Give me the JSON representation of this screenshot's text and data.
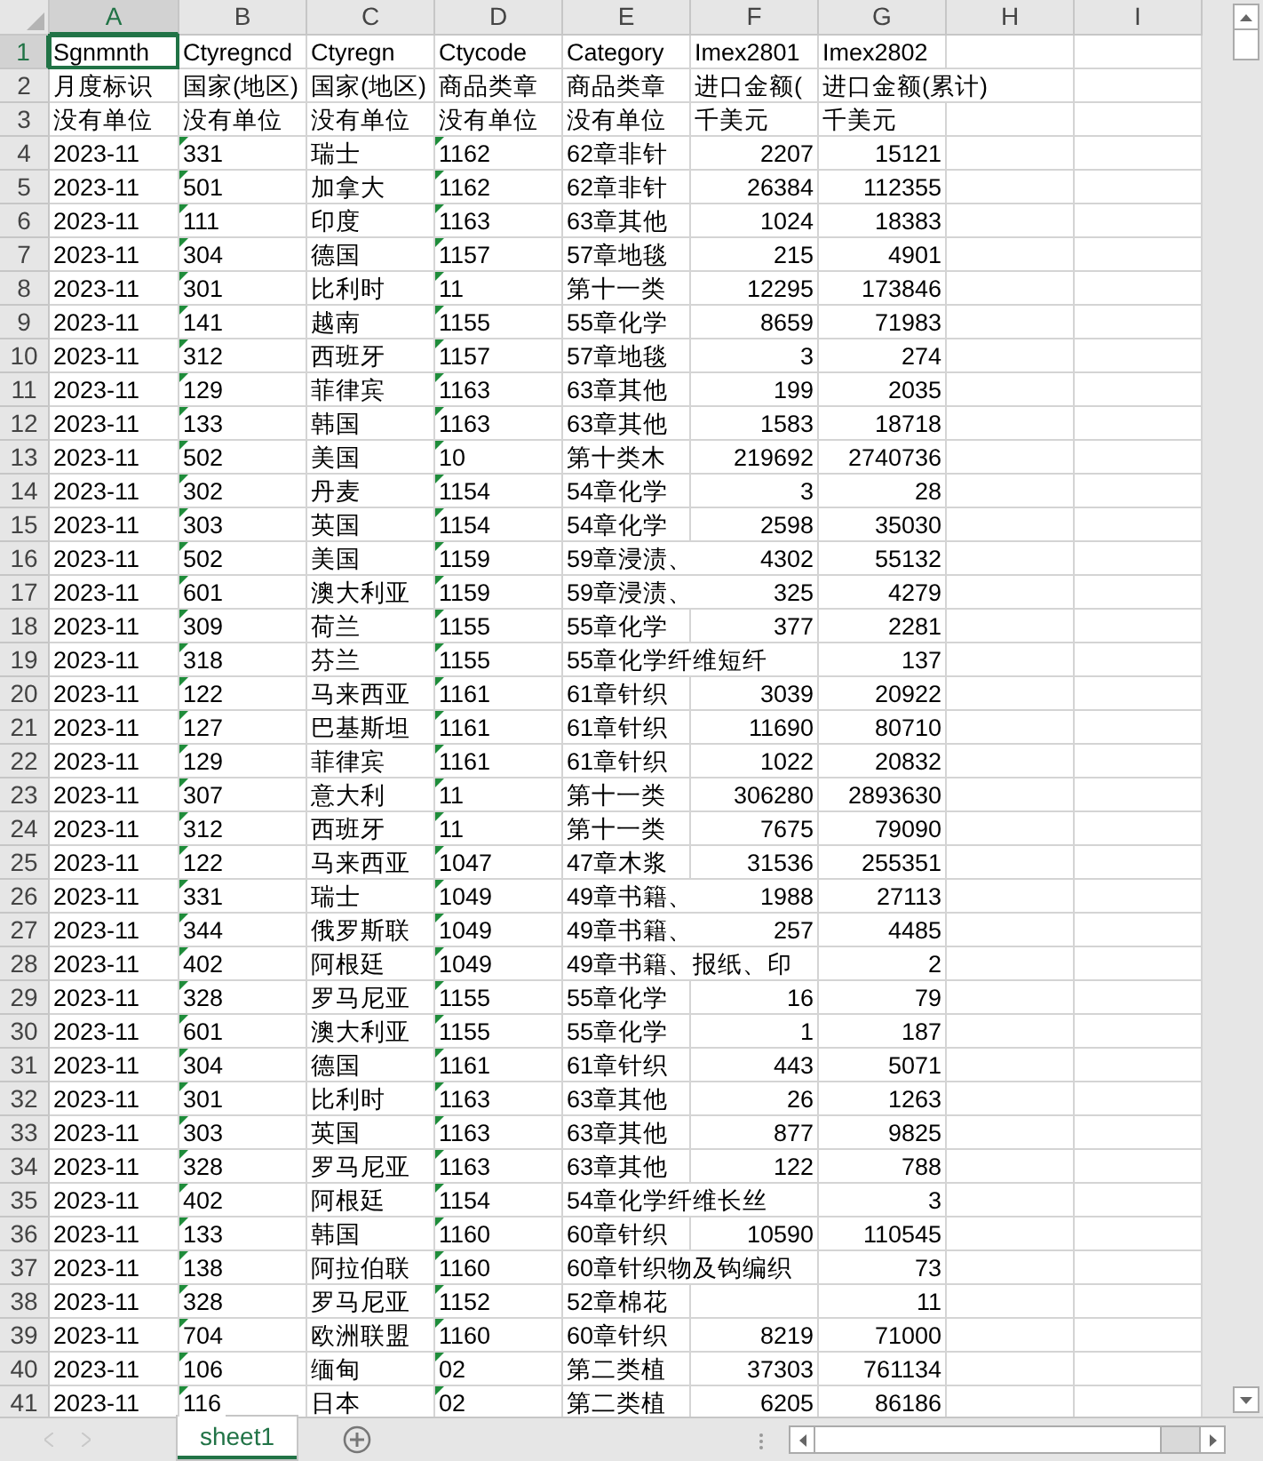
{
  "columns": [
    {
      "label": "A",
      "kind": "text",
      "selected": true
    },
    {
      "label": "B",
      "kind": "code",
      "selected": false
    },
    {
      "label": "C",
      "kind": "text",
      "selected": false
    },
    {
      "label": "D",
      "kind": "code",
      "selected": false
    },
    {
      "label": "E",
      "kind": "text",
      "selected": false
    },
    {
      "label": "F",
      "kind": "number",
      "selected": false
    },
    {
      "label": "G",
      "kind": "number",
      "selected": false
    },
    {
      "label": "H",
      "kind": "text",
      "selected": false
    },
    {
      "label": "I",
      "kind": "text",
      "selected": false
    }
  ],
  "rows": [
    {
      "n": "1",
      "kind": "header",
      "selected": true,
      "cells": [
        "Sgnmnth",
        "Ctyregncd",
        "Ctyregn",
        "Ctycode",
        "Category",
        "Imex2801",
        "Imex2802"
      ]
    },
    {
      "n": "2",
      "kind": "header",
      "selected": false,
      "cells": [
        "月度标识",
        "国家(地区)",
        "国家(地区)",
        "商品类章",
        "商品类章",
        "进口金额(",
        "进口金额(累计)"
      ]
    },
    {
      "n": "3",
      "kind": "header",
      "selected": false,
      "cells": [
        "没有单位",
        "没有单位",
        "没有单位",
        "没有单位",
        "没有单位",
        "千美元",
        "千美元"
      ]
    },
    {
      "n": "4",
      "kind": "data",
      "selected": false,
      "cells": [
        "2023-11",
        "331",
        "瑞士",
        "1162",
        "62章非针",
        "2207",
        "15121"
      ]
    },
    {
      "n": "5",
      "kind": "data",
      "selected": false,
      "cells": [
        "2023-11",
        "501",
        "加拿大",
        "1162",
        "62章非针",
        "26384",
        "112355"
      ]
    },
    {
      "n": "6",
      "kind": "data",
      "selected": false,
      "cells": [
        "2023-11",
        "111",
        "印度",
        "1163",
        "63章其他",
        "1024",
        "18383"
      ]
    },
    {
      "n": "7",
      "kind": "data",
      "selected": false,
      "cells": [
        "2023-11",
        "304",
        "德国",
        "1157",
        "57章地毯",
        "215",
        "4901"
      ]
    },
    {
      "n": "8",
      "kind": "data",
      "selected": false,
      "cells": [
        "2023-11",
        "301",
        "比利时",
        "11",
        "第十一类",
        "12295",
        "173846"
      ]
    },
    {
      "n": "9",
      "kind": "data",
      "selected": false,
      "cells": [
        "2023-11",
        "141",
        "越南",
        "1155",
        "55章化学",
        "8659",
        "71983"
      ]
    },
    {
      "n": "10",
      "kind": "data",
      "selected": false,
      "cells": [
        "2023-11",
        "312",
        "西班牙",
        "1157",
        "57章地毯",
        "3",
        "274"
      ]
    },
    {
      "n": "11",
      "kind": "data",
      "selected": false,
      "cells": [
        "2023-11",
        "129",
        "菲律宾",
        "1163",
        "63章其他",
        "199",
        "2035"
      ]
    },
    {
      "n": "12",
      "kind": "data",
      "selected": false,
      "cells": [
        "2023-11",
        "133",
        "韩国",
        "1163",
        "63章其他",
        "1583",
        "18718"
      ]
    },
    {
      "n": "13",
      "kind": "data",
      "selected": false,
      "cells": [
        "2023-11",
        "502",
        "美国",
        "10",
        "第十类木",
        "219692",
        "2740736"
      ]
    },
    {
      "n": "14",
      "kind": "data",
      "selected": false,
      "cells": [
        "2023-11",
        "302",
        "丹麦",
        "1154",
        "54章化学",
        "3",
        "28"
      ]
    },
    {
      "n": "15",
      "kind": "data",
      "selected": false,
      "cells": [
        "2023-11",
        "303",
        "英国",
        "1154",
        "54章化学",
        "2598",
        "35030"
      ]
    },
    {
      "n": "16",
      "kind": "data",
      "selected": false,
      "cells": [
        "2023-11",
        "502",
        "美国",
        "1159",
        "59章浸渍、",
        "4302",
        "55132"
      ]
    },
    {
      "n": "17",
      "kind": "data",
      "selected": false,
      "cells": [
        "2023-11",
        "601",
        "澳大利亚",
        "1159",
        "59章浸渍、",
        "325",
        "4279"
      ]
    },
    {
      "n": "18",
      "kind": "data",
      "selected": false,
      "cells": [
        "2023-11",
        "309",
        "荷兰",
        "1155",
        "55章化学",
        "377",
        "2281"
      ]
    },
    {
      "n": "19",
      "kind": "data",
      "selected": false,
      "cells": [
        "2023-11",
        "318",
        "芬兰",
        "1155",
        "55章化学纤维短纤",
        null,
        "137"
      ]
    },
    {
      "n": "20",
      "kind": "data",
      "selected": false,
      "cells": [
        "2023-11",
        "122",
        "马来西亚",
        "1161",
        "61章针织",
        "3039",
        "20922"
      ]
    },
    {
      "n": "21",
      "kind": "data",
      "selected": false,
      "cells": [
        "2023-11",
        "127",
        "巴基斯坦",
        "1161",
        "61章针织",
        "11690",
        "80710"
      ]
    },
    {
      "n": "22",
      "kind": "data",
      "selected": false,
      "cells": [
        "2023-11",
        "129",
        "菲律宾",
        "1161",
        "61章针织",
        "1022",
        "20832"
      ]
    },
    {
      "n": "23",
      "kind": "data",
      "selected": false,
      "cells": [
        "2023-11",
        "307",
        "意大利",
        "11",
        "第十一类",
        "306280",
        "2893630"
      ]
    },
    {
      "n": "24",
      "kind": "data",
      "selected": false,
      "cells": [
        "2023-11",
        "312",
        "西班牙",
        "11",
        "第十一类",
        "7675",
        "79090"
      ]
    },
    {
      "n": "25",
      "kind": "data",
      "selected": false,
      "cells": [
        "2023-11",
        "122",
        "马来西亚",
        "1047",
        "47章木浆",
        "31536",
        "255351"
      ]
    },
    {
      "n": "26",
      "kind": "data",
      "selected": false,
      "cells": [
        "2023-11",
        "331",
        "瑞士",
        "1049",
        "49章书籍、",
        "1988",
        "27113"
      ]
    },
    {
      "n": "27",
      "kind": "data",
      "selected": false,
      "cells": [
        "2023-11",
        "344",
        "俄罗斯联",
        "1049",
        "49章书籍、",
        "257",
        "4485"
      ]
    },
    {
      "n": "28",
      "kind": "data",
      "selected": false,
      "cells": [
        "2023-11",
        "402",
        "阿根廷",
        "1049",
        "49章书籍、报纸、印",
        null,
        "2"
      ]
    },
    {
      "n": "29",
      "kind": "data",
      "selected": false,
      "cells": [
        "2023-11",
        "328",
        "罗马尼亚",
        "1155",
        "55章化学",
        "16",
        "79"
      ]
    },
    {
      "n": "30",
      "kind": "data",
      "selected": false,
      "cells": [
        "2023-11",
        "601",
        "澳大利亚",
        "1155",
        "55章化学",
        "1",
        "187"
      ]
    },
    {
      "n": "31",
      "kind": "data",
      "selected": false,
      "cells": [
        "2023-11",
        "304",
        "德国",
        "1161",
        "61章针织",
        "443",
        "5071"
      ]
    },
    {
      "n": "32",
      "kind": "data",
      "selected": false,
      "cells": [
        "2023-11",
        "301",
        "比利时",
        "1163",
        "63章其他",
        "26",
        "1263"
      ]
    },
    {
      "n": "33",
      "kind": "data",
      "selected": false,
      "cells": [
        "2023-11",
        "303",
        "英国",
        "1163",
        "63章其他",
        "877",
        "9825"
      ]
    },
    {
      "n": "34",
      "kind": "data",
      "selected": false,
      "cells": [
        "2023-11",
        "328",
        "罗马尼亚",
        "1163",
        "63章其他",
        "122",
        "788"
      ]
    },
    {
      "n": "35",
      "kind": "data",
      "selected": false,
      "cells": [
        "2023-11",
        "402",
        "阿根廷",
        "1154",
        "54章化学纤维长丝",
        null,
        "3"
      ]
    },
    {
      "n": "36",
      "kind": "data",
      "selected": false,
      "cells": [
        "2023-11",
        "133",
        "韩国",
        "1160",
        "60章针织",
        "10590",
        "110545"
      ]
    },
    {
      "n": "37",
      "kind": "data",
      "selected": false,
      "cells": [
        "2023-11",
        "138",
        "阿拉伯联",
        "1160",
        "60章针织物及钩编织",
        null,
        "73"
      ]
    },
    {
      "n": "38",
      "kind": "data",
      "selected": false,
      "cells": [
        "2023-11",
        "328",
        "罗马尼亚",
        "1152",
        "52章棉花",
        null,
        "11"
      ]
    },
    {
      "n": "39",
      "kind": "data",
      "selected": false,
      "cells": [
        "2023-11",
        "704",
        "欧洲联盟",
        "1160",
        "60章针织",
        "8219",
        "71000"
      ]
    },
    {
      "n": "40",
      "kind": "data",
      "selected": false,
      "cells": [
        "2023-11",
        "106",
        "缅甸",
        "02",
        "第二类植",
        "37303",
        "761134"
      ]
    },
    {
      "n": "41",
      "kind": "data",
      "selected": false,
      "cells": [
        "2023-11",
        "116",
        "日本",
        "02",
        "第二类植",
        "6205",
        "86186"
      ]
    }
  ],
  "sheet_tabs": [
    {
      "label": "sheet1",
      "selected": true
    }
  ]
}
